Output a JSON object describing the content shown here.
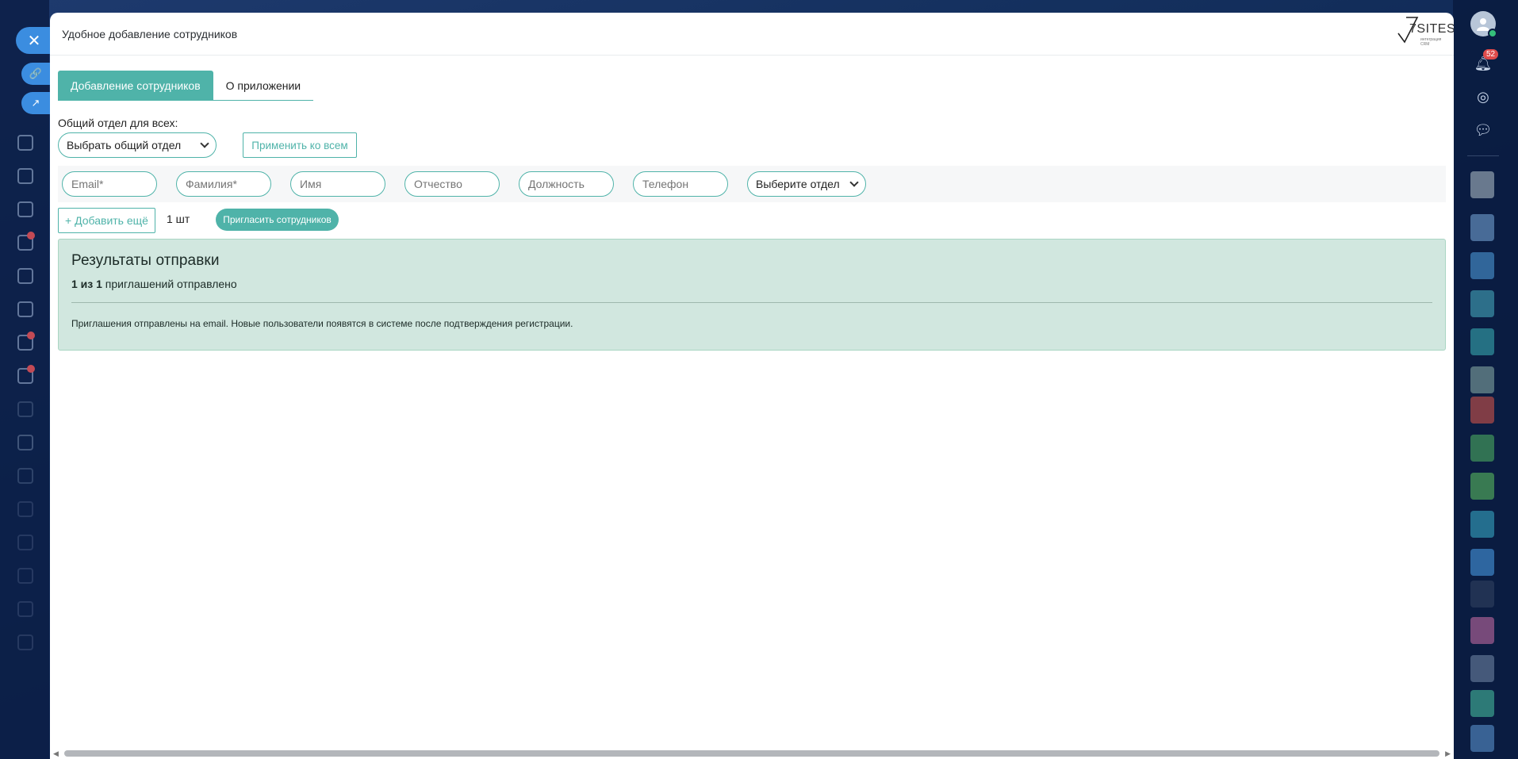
{
  "modal": {
    "title": "Удобное добавление сотрудников",
    "brand": {
      "name": "7SITES",
      "tagline": "интеграция CRM"
    }
  },
  "tabs": [
    {
      "label": "Добавление сотрудников",
      "active": true
    },
    {
      "label": "О приложении",
      "active": false
    }
  ],
  "common_department": {
    "label": "Общий отдел для всех:",
    "select_value": "Выбрать общий отдел",
    "apply_label": "Применить ко всем"
  },
  "employee_row": {
    "email_placeholder": "Email*",
    "lastname_placeholder": "Фамилия*",
    "firstname_placeholder": "Имя",
    "patronymic_placeholder": "Отчество",
    "position_placeholder": "Должность",
    "phone_placeholder": "Телефон",
    "department_select": "Выберите отдел"
  },
  "actions": {
    "add_more_label": "+ Добавить ещё",
    "count_label": "1 шт",
    "invite_label": "Пригласить сотрудников"
  },
  "results": {
    "title": "Результаты отправки",
    "count_bold": "1 из 1",
    "count_rest": " приглашений отправлено",
    "message": "Приглашения отправлены на email. Новые пользователи появятся в системе после подтверждения регистрации."
  },
  "right_sidebar": {
    "notifications_count": "52"
  },
  "colors": {
    "accent": "#4fb3a9",
    "success_bg": "#d1e7df",
    "close_button": "#3b8de0"
  },
  "icons": {
    "close": "close-icon",
    "link": "link-icon",
    "external": "external-link-icon",
    "bell": "bell-icon",
    "fingerprint": "fingerprint-icon",
    "chat": "chat-icon",
    "avatar": "user-avatar-icon"
  }
}
